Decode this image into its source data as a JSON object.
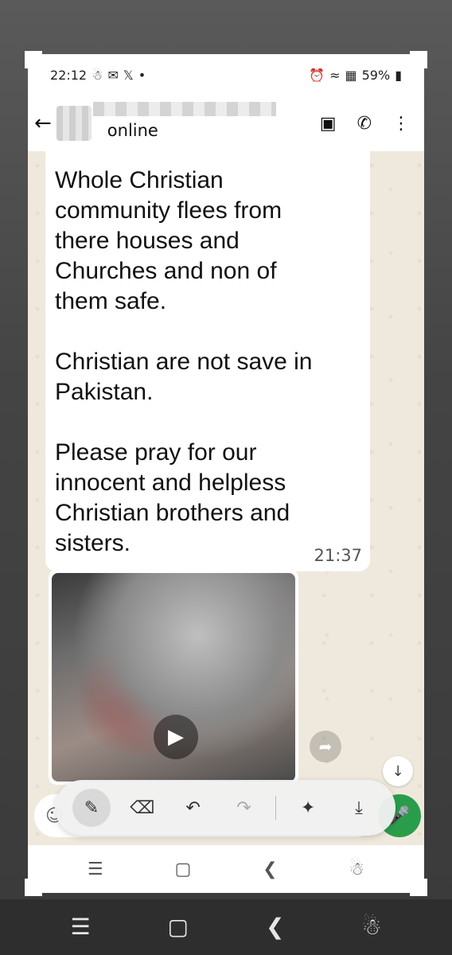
{
  "status_bar": {
    "time": "22:12",
    "left_icons": [
      "notification-icon",
      "mail-icon",
      "x-icon"
    ],
    "dot": "•",
    "battery": "59%"
  },
  "header": {
    "back_icon": "back-arrow-icon",
    "status": "online",
    "actions": [
      "video-call-icon",
      "phone-icon",
      "more-icon"
    ]
  },
  "message": {
    "text": "Whole Christian\ncommunity flees from\nthere houses and\nChurches and non of\nthem safe.\n\nChristian are not save in\nPakistan.\n\nPlease pray for our\ninnocent and helpless\nChristian brothers and\nsisters.",
    "time": "21:37"
  },
  "video": {
    "play_icon": "play-icon"
  },
  "edit_toolbar": {
    "tools": [
      "pen-icon",
      "eraser-icon",
      "undo-icon",
      "redo-icon",
      "share-icon",
      "download-icon"
    ]
  },
  "colors": {
    "accent_green": "#2a9d4b",
    "chat_background": "#efe9dd"
  }
}
